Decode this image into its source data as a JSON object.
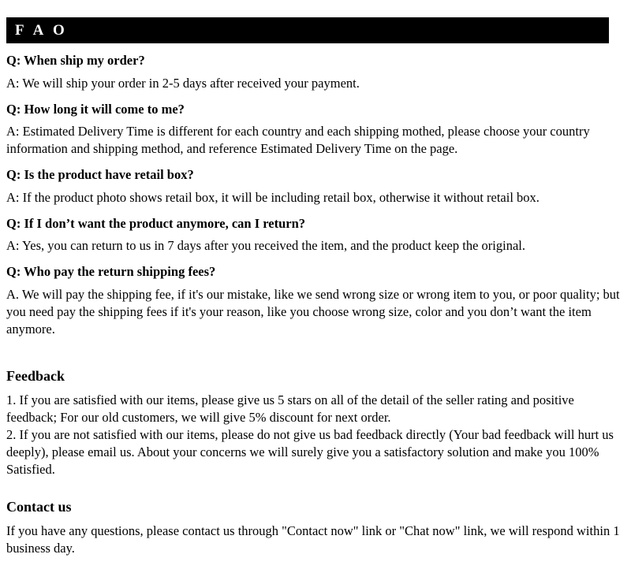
{
  "banner": {
    "title": "F A O"
  },
  "faq": {
    "items": [
      {
        "question": "Q: When ship my order?",
        "answer": "A: We will ship your order in 2-5 days after received your payment."
      },
      {
        "question": "Q: How long it will come to me?",
        "answer": "A: Estimated Delivery Time is different for each country and each shipping mothed, please choose your country information and shipping method, and reference Estimated Delivery Time on the page."
      },
      {
        "question": "Q: Is the product have retail box?",
        "answer": "A: If  the product photo shows retail box, it will be including retail box, otherwise it without retail box."
      },
      {
        "question": "Q: If I don’t want the product anymore, can I return?",
        "answer": "A: Yes, you can return to us in 7 days after you received the item, and the product keep the original."
      },
      {
        "question": "Q: Who pay the return shipping fees?",
        "answer": "A.  We will pay the shipping fee, if  it's our mistake, like we send wrong size or wrong item to you, or poor quality; but you need pay the shipping fees if  it's your reason, like you choose wrong size, color and you don’t want the item anymore."
      }
    ]
  },
  "feedback": {
    "heading": "Feedback",
    "item1": "1.  If you are satisfied with our items, please give us 5 stars on all of the detail of the seller rating and positive feedback; For our old customers, we will give 5% discount for next order.",
    "item2": "2.  If you are not satisfied with our items, please do not give us bad feedback directly (Your bad feedback will hurt us deeply), please email us. About your concerns we will surely give you a satisfactory solution and make you 100% Satisfied."
  },
  "contact": {
    "heading": "Contact us",
    "body": "If you have any questions, please contact us through \"Contact now\" link or \"Chat now\" link, we will respond within 1 business day."
  },
  "colors": {
    "banner_background": "#000000",
    "banner_text": "#ffffff",
    "page_background": "#ffffff",
    "body_text": "#000000"
  }
}
